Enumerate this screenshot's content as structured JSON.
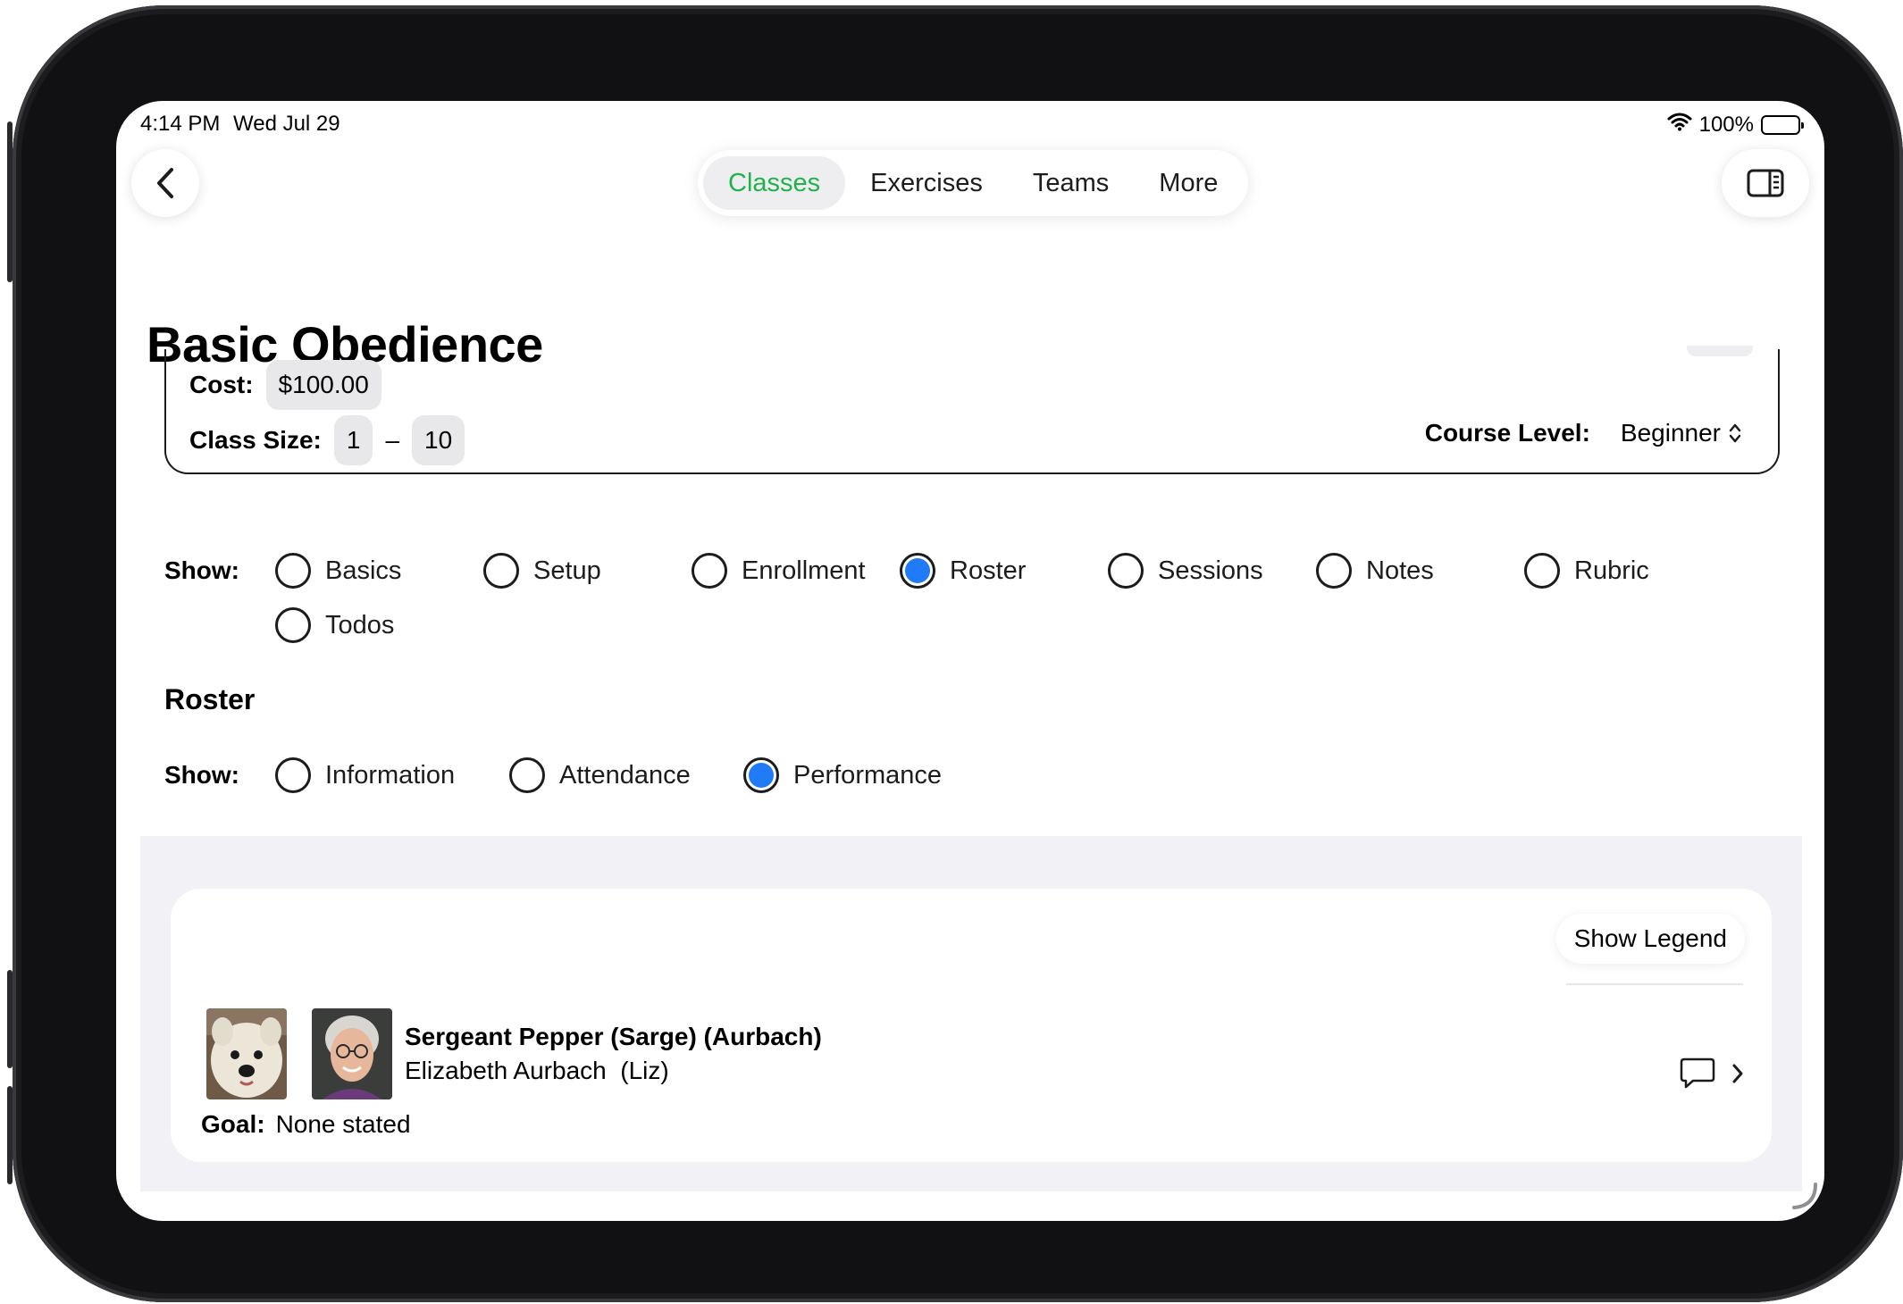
{
  "status": {
    "time": "4:14 PM",
    "date": "Wed Jul 29",
    "battery": "100%"
  },
  "nav": {
    "tabs": [
      {
        "label": "Classes",
        "active": true
      },
      {
        "label": "Exercises",
        "active": false
      },
      {
        "label": "Teams",
        "active": false
      },
      {
        "label": "More",
        "active": false
      }
    ],
    "accent_color": "#22b24c"
  },
  "page": {
    "title": "Basic Obedience"
  },
  "basics": {
    "cost_label": "Cost:",
    "cost_value": "$100.00",
    "class_size_label": "Class Size:",
    "class_size_min": "1",
    "class_size_sep": "–",
    "class_size_max": "10",
    "course_level_label": "Course Level:",
    "course_level_value": "Beginner"
  },
  "section_show": {
    "label": "Show:",
    "options": [
      {
        "label": "Basics",
        "selected": false
      },
      {
        "label": "Setup",
        "selected": false
      },
      {
        "label": "Enrollment",
        "selected": false
      },
      {
        "label": "Roster",
        "selected": true
      },
      {
        "label": "Sessions",
        "selected": false
      },
      {
        "label": "Notes",
        "selected": false
      },
      {
        "label": "Rubric",
        "selected": false
      },
      {
        "label": "Todos",
        "selected": false
      }
    ]
  },
  "roster": {
    "title": "Roster",
    "show_label": "Show:",
    "options": [
      {
        "label": "Information",
        "selected": false
      },
      {
        "label": "Attendance",
        "selected": false
      },
      {
        "label": "Performance",
        "selected": true
      }
    ]
  },
  "performance": {
    "legend_button": "Show Legend",
    "entries": [
      {
        "dog_name": "Sergeant Pepper (Sarge) (Aurbach)",
        "owner_name": "Elizabeth Aurbach  (Liz)",
        "goal_label": "Goal:",
        "goal_value": "None stated"
      }
    ]
  },
  "selected_color": "#1f7cf6"
}
